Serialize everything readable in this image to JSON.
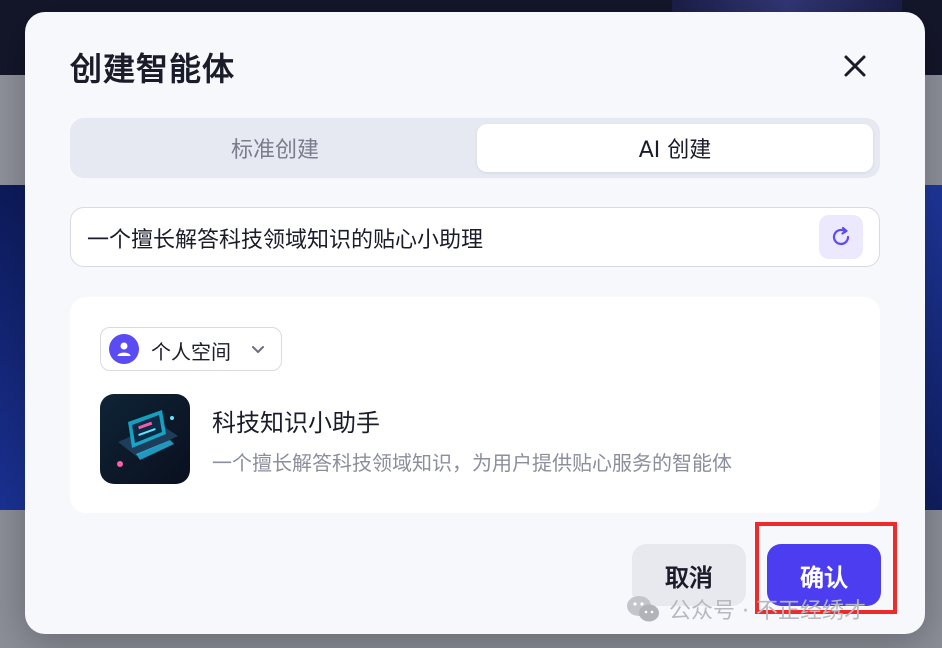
{
  "modal": {
    "title": "创建智能体",
    "close_icon": "close-icon"
  },
  "tabs": [
    {
      "label": "标准创建",
      "active": false
    },
    {
      "label": "AI 创建",
      "active": true
    }
  ],
  "prompt": {
    "value": "一个擅长解答科技领域知识的贴心小助理",
    "refresh_icon": "refresh-icon"
  },
  "preview": {
    "space": {
      "label": "个人空间",
      "icon": "user-icon"
    },
    "agent": {
      "name": "科技知识小助手",
      "description": "一个擅长解答科技领域知识，为用户提供贴心服务的智能体"
    }
  },
  "footer": {
    "cancel_label": "取消",
    "confirm_label": "确认"
  },
  "watermark": {
    "text": "公众号 · 不正经绣才",
    "icon": "wechat-icon"
  },
  "colors": {
    "accent": "#4d3df0",
    "highlight": "#ec2b2b",
    "panel": "#f7f8fc"
  }
}
